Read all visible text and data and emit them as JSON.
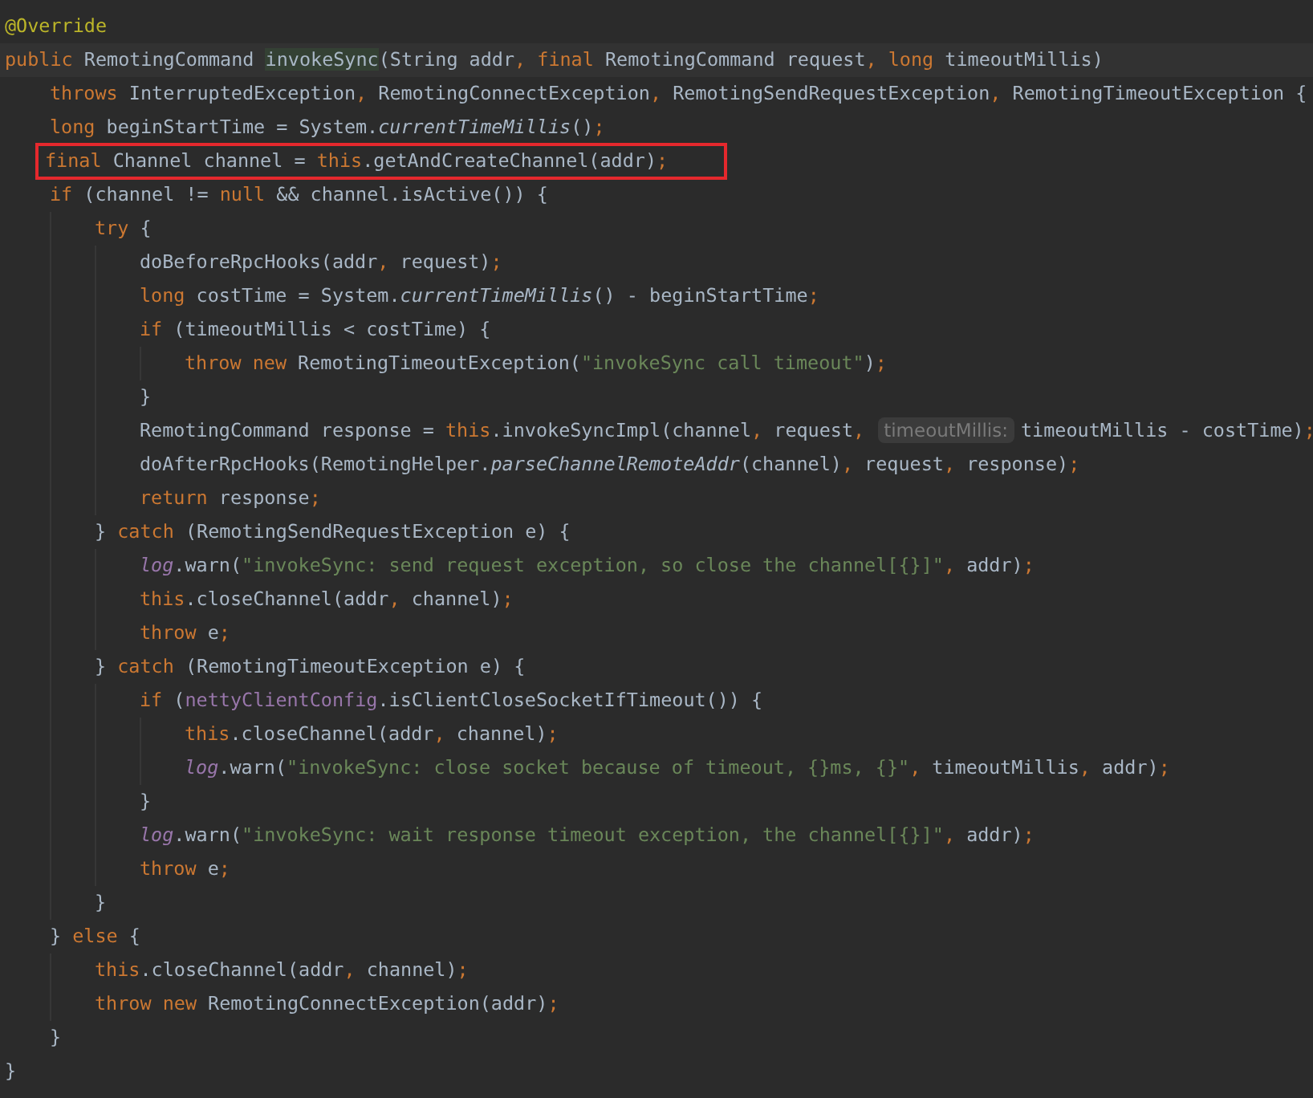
{
  "editor": {
    "lines": [
      {
        "current": false,
        "boxed": false,
        "tokens": [
          {
            "kind": "annotation",
            "text": "@Override"
          }
        ]
      },
      {
        "current": true,
        "boxed": false,
        "tokens": [
          {
            "kind": "keyword",
            "text": "public"
          },
          {
            "kind": "plain",
            "text": " RemotingCommand "
          },
          {
            "kind": "declaration",
            "text": "invokeSync"
          },
          {
            "kind": "plain",
            "text": "(String addr"
          },
          {
            "kind": "keyword",
            "text": ", final"
          },
          {
            "kind": "plain",
            "text": " RemotingCommand request"
          },
          {
            "kind": "keyword",
            "text": ", long"
          },
          {
            "kind": "plain",
            "text": " timeoutMillis)"
          }
        ],
        "children": [
          {
            "current": false,
            "boxed": false,
            "tokens": [
              {
                "kind": "keyword",
                "text": "throws"
              },
              {
                "kind": "plain",
                "text": " InterruptedException"
              },
              {
                "kind": "keyword",
                "text": ","
              },
              {
                "kind": "plain",
                "text": " RemotingConnectException"
              },
              {
                "kind": "keyword",
                "text": ","
              },
              {
                "kind": "plain",
                "text": " RemotingSendRequestException"
              },
              {
                "kind": "keyword",
                "text": ","
              },
              {
                "kind": "plain",
                "text": " RemotingTimeoutException {"
              }
            ]
          },
          {
            "current": false,
            "boxed": false,
            "tokens": [
              {
                "kind": "keyword",
                "text": "long"
              },
              {
                "kind": "plain",
                "text": " beginStartTime = System."
              },
              {
                "kind": "static",
                "text": "currentTimeMillis"
              },
              {
                "kind": "plain",
                "text": "()"
              },
              {
                "kind": "keyword",
                "text": ";"
              }
            ]
          },
          {
            "current": false,
            "boxed": true,
            "tokens": [
              {
                "kind": "keyword",
                "text": "final"
              },
              {
                "kind": "plain",
                "text": " Channel channel = "
              },
              {
                "kind": "keyword",
                "text": "this"
              },
              {
                "kind": "plain",
                "text": ".getAndCreateChannel(addr)"
              },
              {
                "kind": "keyword",
                "text": ";"
              }
            ]
          },
          {
            "current": false,
            "boxed": false,
            "tokens": [
              {
                "kind": "keyword",
                "text": "if"
              },
              {
                "kind": "plain",
                "text": " (channel != "
              },
              {
                "kind": "keyword",
                "text": "null"
              },
              {
                "kind": "plain",
                "text": " && channel.isActive()) {"
              }
            ],
            "children": [
              {
                "current": false,
                "boxed": false,
                "tokens": [
                  {
                    "kind": "keyword",
                    "text": "try"
                  },
                  {
                    "kind": "plain",
                    "text": " {"
                  }
                ],
                "children": [
                  {
                    "current": false,
                    "boxed": false,
                    "tokens": [
                      {
                        "kind": "plain",
                        "text": "doBeforeRpcHooks(addr"
                      },
                      {
                        "kind": "keyword",
                        "text": ","
                      },
                      {
                        "kind": "plain",
                        "text": " request)"
                      },
                      {
                        "kind": "keyword",
                        "text": ";"
                      }
                    ]
                  },
                  {
                    "current": false,
                    "boxed": false,
                    "tokens": [
                      {
                        "kind": "keyword",
                        "text": "long"
                      },
                      {
                        "kind": "plain",
                        "text": " costTime = System."
                      },
                      {
                        "kind": "static",
                        "text": "currentTimeMillis"
                      },
                      {
                        "kind": "plain",
                        "text": "() - beginStartTime"
                      },
                      {
                        "kind": "keyword",
                        "text": ";"
                      }
                    ]
                  },
                  {
                    "current": false,
                    "boxed": false,
                    "tokens": [
                      {
                        "kind": "keyword",
                        "text": "if"
                      },
                      {
                        "kind": "plain",
                        "text": " (timeoutMillis < costTime) {"
                      }
                    ],
                    "children": [
                      {
                        "current": false,
                        "boxed": false,
                        "tokens": [
                          {
                            "kind": "keyword",
                            "text": "throw new"
                          },
                          {
                            "kind": "plain",
                            "text": " RemotingTimeoutException("
                          },
                          {
                            "kind": "string",
                            "text": "\"invokeSync call timeout\""
                          },
                          {
                            "kind": "plain",
                            "text": ")"
                          },
                          {
                            "kind": "keyword",
                            "text": ";"
                          }
                        ]
                      }
                    ]
                  },
                  {
                    "current": false,
                    "boxed": false,
                    "tokens": [
                      {
                        "kind": "plain",
                        "text": "}"
                      }
                    ]
                  },
                  {
                    "current": false,
                    "boxed": false,
                    "tokens": [
                      {
                        "kind": "plain",
                        "text": "RemotingCommand response = "
                      },
                      {
                        "kind": "keyword",
                        "text": "this"
                      },
                      {
                        "kind": "plain",
                        "text": ".invokeSyncImpl(channel"
                      },
                      {
                        "kind": "keyword",
                        "text": ","
                      },
                      {
                        "kind": "plain",
                        "text": " request"
                      },
                      {
                        "kind": "keyword",
                        "text": ","
                      },
                      {
                        "kind": "hint",
                        "text": "timeoutMillis:"
                      },
                      {
                        "kind": "plain",
                        "text": "timeoutMillis - costTime)"
                      },
                      {
                        "kind": "keyword",
                        "text": ";"
                      }
                    ]
                  },
                  {
                    "current": false,
                    "boxed": false,
                    "tokens": [
                      {
                        "kind": "plain",
                        "text": "doAfterRpcHooks(RemotingHelper."
                      },
                      {
                        "kind": "static",
                        "text": "parseChannelRemoteAddr"
                      },
                      {
                        "kind": "plain",
                        "text": "(channel)"
                      },
                      {
                        "kind": "keyword",
                        "text": ","
                      },
                      {
                        "kind": "plain",
                        "text": " request"
                      },
                      {
                        "kind": "keyword",
                        "text": ","
                      },
                      {
                        "kind": "plain",
                        "text": " response)"
                      },
                      {
                        "kind": "keyword",
                        "text": ";"
                      }
                    ]
                  },
                  {
                    "current": false,
                    "boxed": false,
                    "tokens": [
                      {
                        "kind": "keyword",
                        "text": "return"
                      },
                      {
                        "kind": "plain",
                        "text": " response"
                      },
                      {
                        "kind": "keyword",
                        "text": ";"
                      }
                    ]
                  }
                ]
              },
              {
                "current": false,
                "boxed": false,
                "tokens": [
                  {
                    "kind": "plain",
                    "text": "} "
                  },
                  {
                    "kind": "keyword",
                    "text": "catch"
                  },
                  {
                    "kind": "plain",
                    "text": " (RemotingSendRequestException e) {"
                  }
                ],
                "children": [
                  {
                    "current": false,
                    "boxed": false,
                    "tokens": [
                      {
                        "kind": "field",
                        "text": "log"
                      },
                      {
                        "kind": "plain",
                        "text": ".warn("
                      },
                      {
                        "kind": "string",
                        "text": "\"invokeSync: send request exception, so close the channel[{}]\""
                      },
                      {
                        "kind": "keyword",
                        "text": ","
                      },
                      {
                        "kind": "plain",
                        "text": " addr)"
                      },
                      {
                        "kind": "keyword",
                        "text": ";"
                      }
                    ]
                  },
                  {
                    "current": false,
                    "boxed": false,
                    "tokens": [
                      {
                        "kind": "keyword",
                        "text": "this"
                      },
                      {
                        "kind": "plain",
                        "text": ".closeChannel(addr"
                      },
                      {
                        "kind": "keyword",
                        "text": ","
                      },
                      {
                        "kind": "plain",
                        "text": " channel)"
                      },
                      {
                        "kind": "keyword",
                        "text": ";"
                      }
                    ]
                  },
                  {
                    "current": false,
                    "boxed": false,
                    "tokens": [
                      {
                        "kind": "keyword",
                        "text": "throw"
                      },
                      {
                        "kind": "plain",
                        "text": " e"
                      },
                      {
                        "kind": "keyword",
                        "text": ";"
                      }
                    ]
                  }
                ]
              },
              {
                "current": false,
                "boxed": false,
                "tokens": [
                  {
                    "kind": "plain",
                    "text": "} "
                  },
                  {
                    "kind": "keyword",
                    "text": "catch"
                  },
                  {
                    "kind": "plain",
                    "text": " (RemotingTimeoutException e) {"
                  }
                ],
                "children": [
                  {
                    "current": false,
                    "boxed": false,
                    "tokens": [
                      {
                        "kind": "keyword",
                        "text": "if"
                      },
                      {
                        "kind": "plain",
                        "text": " ("
                      },
                      {
                        "kind": "member",
                        "text": "nettyClientConfig"
                      },
                      {
                        "kind": "plain",
                        "text": ".isClientCloseSocketIfTimeout()) {"
                      }
                    ],
                    "children": [
                      {
                        "current": false,
                        "boxed": false,
                        "tokens": [
                          {
                            "kind": "keyword",
                            "text": "this"
                          },
                          {
                            "kind": "plain",
                            "text": ".closeChannel(addr"
                          },
                          {
                            "kind": "keyword",
                            "text": ","
                          },
                          {
                            "kind": "plain",
                            "text": " channel)"
                          },
                          {
                            "kind": "keyword",
                            "text": ";"
                          }
                        ]
                      },
                      {
                        "current": false,
                        "boxed": false,
                        "tokens": [
                          {
                            "kind": "field",
                            "text": "log"
                          },
                          {
                            "kind": "plain",
                            "text": ".warn("
                          },
                          {
                            "kind": "string",
                            "text": "\"invokeSync: close socket because of timeout, {}ms, {}\""
                          },
                          {
                            "kind": "keyword",
                            "text": ","
                          },
                          {
                            "kind": "plain",
                            "text": " timeoutMillis"
                          },
                          {
                            "kind": "keyword",
                            "text": ","
                          },
                          {
                            "kind": "plain",
                            "text": " addr)"
                          },
                          {
                            "kind": "keyword",
                            "text": ";"
                          }
                        ]
                      }
                    ]
                  },
                  {
                    "current": false,
                    "boxed": false,
                    "tokens": [
                      {
                        "kind": "plain",
                        "text": "}"
                      }
                    ]
                  },
                  {
                    "current": false,
                    "boxed": false,
                    "tokens": [
                      {
                        "kind": "field",
                        "text": "log"
                      },
                      {
                        "kind": "plain",
                        "text": ".warn("
                      },
                      {
                        "kind": "string",
                        "text": "\"invokeSync: wait response timeout exception, the channel[{}]\""
                      },
                      {
                        "kind": "keyword",
                        "text": ","
                      },
                      {
                        "kind": "plain",
                        "text": " addr)"
                      },
                      {
                        "kind": "keyword",
                        "text": ";"
                      }
                    ]
                  },
                  {
                    "current": false,
                    "boxed": false,
                    "tokens": [
                      {
                        "kind": "keyword",
                        "text": "throw"
                      },
                      {
                        "kind": "plain",
                        "text": " e"
                      },
                      {
                        "kind": "keyword",
                        "text": ";"
                      }
                    ]
                  }
                ]
              },
              {
                "current": false,
                "boxed": false,
                "tokens": [
                  {
                    "kind": "plain",
                    "text": "}"
                  }
                ]
              }
            ]
          },
          {
            "current": false,
            "boxed": false,
            "tokens": [
              {
                "kind": "plain",
                "text": "} "
              },
              {
                "kind": "keyword",
                "text": "else"
              },
              {
                "kind": "plain",
                "text": " {"
              }
            ],
            "children": [
              {
                "current": false,
                "boxed": false,
                "tokens": [
                  {
                    "kind": "keyword",
                    "text": "this"
                  },
                  {
                    "kind": "plain",
                    "text": ".closeChannel(addr"
                  },
                  {
                    "kind": "keyword",
                    "text": ","
                  },
                  {
                    "kind": "plain",
                    "text": " channel)"
                  },
                  {
                    "kind": "keyword",
                    "text": ";"
                  }
                ]
              },
              {
                "current": false,
                "boxed": false,
                "tokens": [
                  {
                    "kind": "keyword",
                    "text": "throw new"
                  },
                  {
                    "kind": "plain",
                    "text": " RemotingConnectException(addr)"
                  },
                  {
                    "kind": "keyword",
                    "text": ";"
                  }
                ]
              }
            ]
          },
          {
            "current": false,
            "boxed": false,
            "tokens": [
              {
                "kind": "plain",
                "text": "}"
              }
            ]
          }
        ]
      },
      {
        "current": false,
        "boxed": false,
        "tokens": [
          {
            "kind": "plain",
            "text": "}"
          }
        ]
      }
    ]
  }
}
